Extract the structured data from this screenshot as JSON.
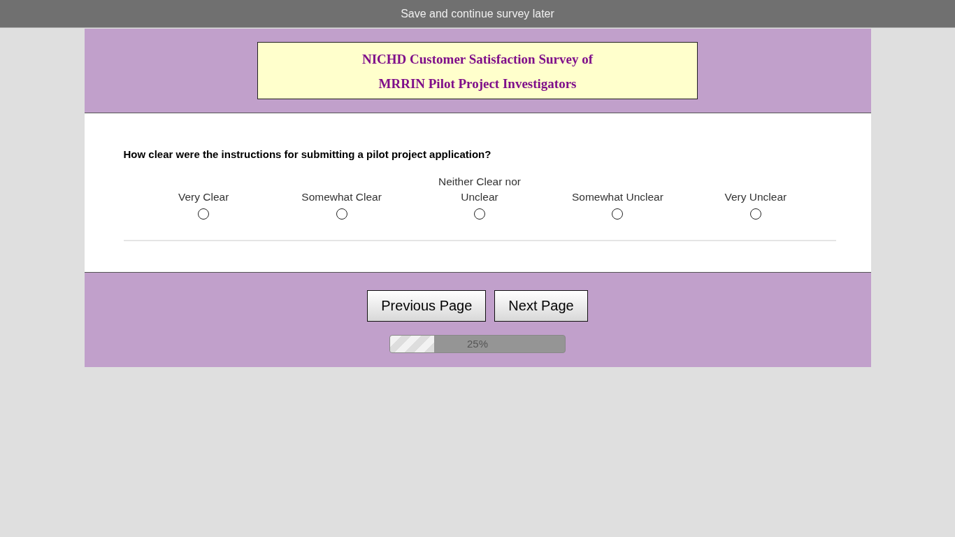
{
  "top_bar": {
    "link": "Save and continue survey later"
  },
  "header": {
    "title_lines": [
      "NICHD Customer Satisfaction Survey of",
      "MRRIN Pilot Project Investigators"
    ]
  },
  "question": {
    "text": "How clear were the instructions for submitting a pilot project application?",
    "options": [
      {
        "label": "Very Clear",
        "selected": false
      },
      {
        "label": "Somewhat Clear",
        "selected": false
      },
      {
        "label": "Neither Clear nor Unclear",
        "selected": false
      },
      {
        "label": "Somewhat Unclear",
        "selected": false
      },
      {
        "label": "Very Unclear",
        "selected": false
      }
    ]
  },
  "buttons": [
    "Previous Page",
    "Next Page"
  ],
  "progress": {
    "level": 0.25,
    "reading": "25%"
  }
}
